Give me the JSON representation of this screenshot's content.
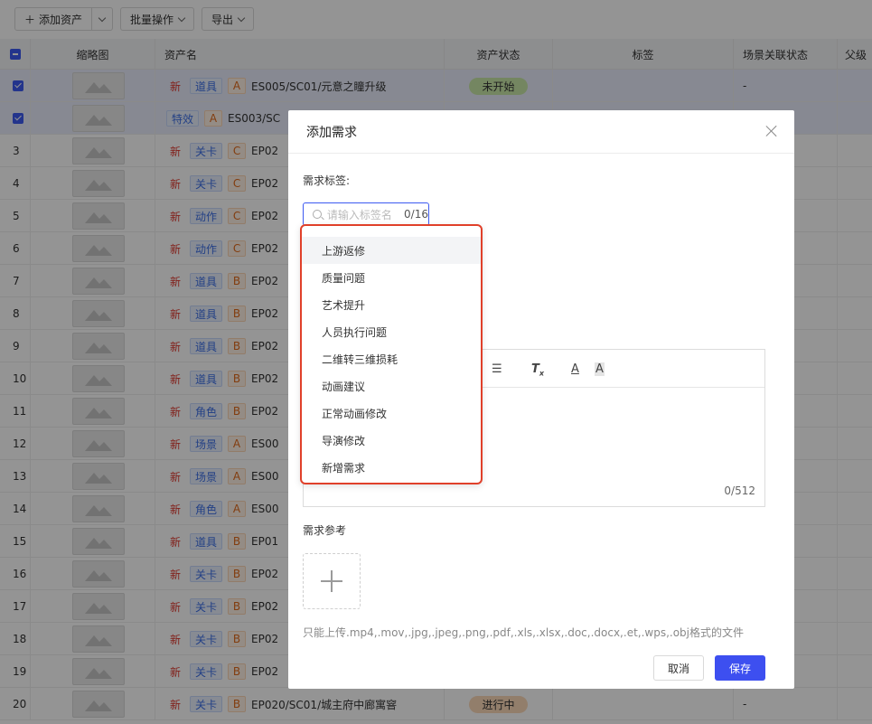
{
  "toolbar": {
    "add_asset": "添加资产",
    "batch": "批量操作",
    "export": "导出"
  },
  "table": {
    "headers": {
      "thumb": "缩略图",
      "name": "资产名",
      "status": "资产状态",
      "tag": "标签",
      "scene": "场景关联状态",
      "parent": "父级"
    },
    "rows": [
      {
        "no": "",
        "selected": true,
        "new": "新",
        "type": "道具",
        "grade": "A",
        "name": "ES005/SC01/元意之瞳升级",
        "status": "未开始",
        "status_color": "#c9e7a8",
        "scene": "-"
      },
      {
        "no": "",
        "selected": true,
        "new": "",
        "type": "特效",
        "grade": "A",
        "name": "ES003/SC",
        "status": "",
        "status_color": "",
        "scene": ""
      },
      {
        "no": "3",
        "selected": false,
        "new": "新",
        "type": "关卡",
        "grade": "C",
        "name": "EP02",
        "status": "",
        "status_color": "",
        "scene": ""
      },
      {
        "no": "4",
        "selected": false,
        "new": "新",
        "type": "关卡",
        "grade": "C",
        "name": "EP02",
        "status": "",
        "status_color": "",
        "scene": ""
      },
      {
        "no": "5",
        "selected": false,
        "new": "新",
        "type": "动作",
        "grade": "C",
        "name": "EP02",
        "status": "",
        "status_color": "",
        "scene": ""
      },
      {
        "no": "6",
        "selected": false,
        "new": "新",
        "type": "动作",
        "grade": "C",
        "name": "EP02",
        "status": "",
        "status_color": "",
        "scene": ""
      },
      {
        "no": "7",
        "selected": false,
        "new": "新",
        "type": "道具",
        "grade": "B",
        "name": "EP02",
        "status": "",
        "status_color": "",
        "scene": ""
      },
      {
        "no": "8",
        "selected": false,
        "new": "新",
        "type": "道具",
        "grade": "B",
        "name": "EP02",
        "status": "",
        "status_color": "",
        "scene": ""
      },
      {
        "no": "9",
        "selected": false,
        "new": "新",
        "type": "道具",
        "grade": "B",
        "name": "EP02",
        "status": "",
        "status_color": "",
        "scene": ""
      },
      {
        "no": "10",
        "selected": false,
        "new": "新",
        "type": "道具",
        "grade": "B",
        "name": "EP02",
        "status": "",
        "status_color": "",
        "scene": ""
      },
      {
        "no": "11",
        "selected": false,
        "new": "新",
        "type": "角色",
        "grade": "B",
        "name": "EP02",
        "status": "",
        "status_color": "",
        "scene": ""
      },
      {
        "no": "12",
        "selected": false,
        "new": "新",
        "type": "场景",
        "grade": "A",
        "name": "ES00",
        "status": "",
        "status_color": "",
        "scene": ""
      },
      {
        "no": "13",
        "selected": false,
        "new": "新",
        "type": "场景",
        "grade": "A",
        "name": "ES00",
        "status": "",
        "status_color": "",
        "scene": ""
      },
      {
        "no": "14",
        "selected": false,
        "new": "新",
        "type": "角色",
        "grade": "A",
        "name": "ES00",
        "status": "",
        "status_color": "",
        "scene": ""
      },
      {
        "no": "15",
        "selected": false,
        "new": "新",
        "type": "道具",
        "grade": "B",
        "name": "EP01",
        "status": "",
        "status_color": "",
        "scene": ""
      },
      {
        "no": "16",
        "selected": false,
        "new": "新",
        "type": "关卡",
        "grade": "B",
        "name": "EP02",
        "status": "",
        "status_color": "",
        "scene": ""
      },
      {
        "no": "17",
        "selected": false,
        "new": "新",
        "type": "关卡",
        "grade": "B",
        "name": "EP02",
        "status": "",
        "status_color": "",
        "scene": ""
      },
      {
        "no": "18",
        "selected": false,
        "new": "新",
        "type": "关卡",
        "grade": "B",
        "name": "EP02",
        "status": "",
        "status_color": "",
        "scene": ""
      },
      {
        "no": "19",
        "selected": false,
        "new": "新",
        "type": "关卡",
        "grade": "B",
        "name": "EP02",
        "status": "",
        "status_color": "",
        "scene": ""
      },
      {
        "no": "20",
        "selected": false,
        "new": "新",
        "type": "关卡",
        "grade": "B",
        "name": "EP020/SC01/城主府中廊寓窨",
        "status": "进行中",
        "status_color": "#fbd9b8",
        "scene": "-"
      }
    ]
  },
  "modal": {
    "title": "添加需求",
    "tag_label": "需求标签:",
    "tag_placeholder": "请输入标签名",
    "tag_count": "0/16",
    "editor_count": "0/512",
    "ref_label": "需求参考",
    "upload_hint": "只能上传.mp4,.mov,.jpg,.jpeg,.png,.pdf,.xls,.xlsx,.doc,.docx,.et,.wps,.obj格式的文件",
    "cancel": "取消",
    "save": "保存"
  },
  "dropdown": {
    "items": [
      "上游返修",
      "质量问题",
      "艺术提升",
      "人员执行问题",
      "二维转三维损耗",
      "动画建议",
      "正常动画修改",
      "导演修改",
      "新增需求"
    ]
  },
  "colors": {
    "accent": "#3d4ff0",
    "highlight_border": "#e0402a"
  }
}
